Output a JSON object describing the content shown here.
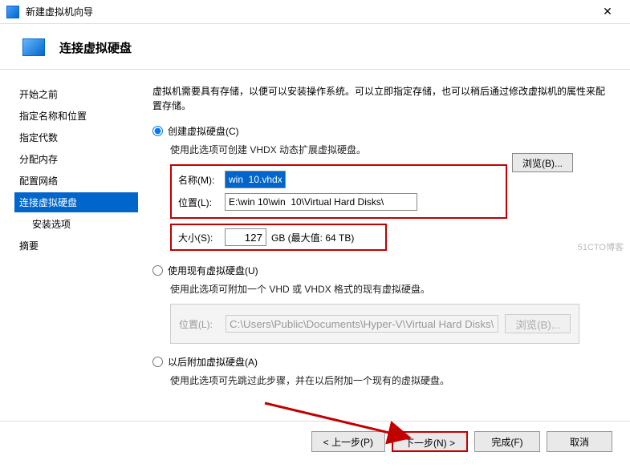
{
  "window": {
    "title": "新建虚拟机向导"
  },
  "header": {
    "title": "连接虚拟硬盘"
  },
  "sidebar": {
    "steps": [
      "开始之前",
      "指定名称和位置",
      "指定代数",
      "分配内存",
      "配置网络",
      "连接虚拟硬盘",
      "安装选项",
      "摘要"
    ]
  },
  "content": {
    "intro": "虚拟机需要具有存储，以便可以安装操作系统。可以立即指定存储，也可以稍后通过修改虚拟机的属性来配置存储。",
    "opt_create": {
      "label": "创建虚拟硬盘(C)",
      "desc": "使用此选项可创建 VHDX 动态扩展虚拟硬盘。"
    },
    "name": {
      "label": "名称(M):",
      "value": "win  10.vhdx"
    },
    "location": {
      "label": "位置(L):",
      "value": "E:\\win 10\\win  10\\Virtual Hard Disks\\",
      "browse": "浏览(B)..."
    },
    "size": {
      "label": "大小(S):",
      "value": "127",
      "suffix": "GB (最大值: 64 TB)"
    },
    "opt_use": {
      "label": "使用现有虚拟硬盘(U)",
      "desc": "使用此选项可附加一个 VHD 或 VHDX 格式的现有虚拟硬盘。"
    },
    "disabled_loc": {
      "label": "位置(L):",
      "value": "C:\\Users\\Public\\Documents\\Hyper-V\\Virtual Hard Disks\\",
      "browse": "浏览(B)..."
    },
    "opt_later": {
      "label": "以后附加虚拟硬盘(A)",
      "desc": "使用此选项可先跳过此步骤，并在以后附加一个现有的虚拟硬盘。"
    }
  },
  "buttons": {
    "prev": "< 上一步(P)",
    "next": "下一步(N) >",
    "finish": "完成(F)",
    "cancel": "取消"
  },
  "watermark": "51CTO博客"
}
